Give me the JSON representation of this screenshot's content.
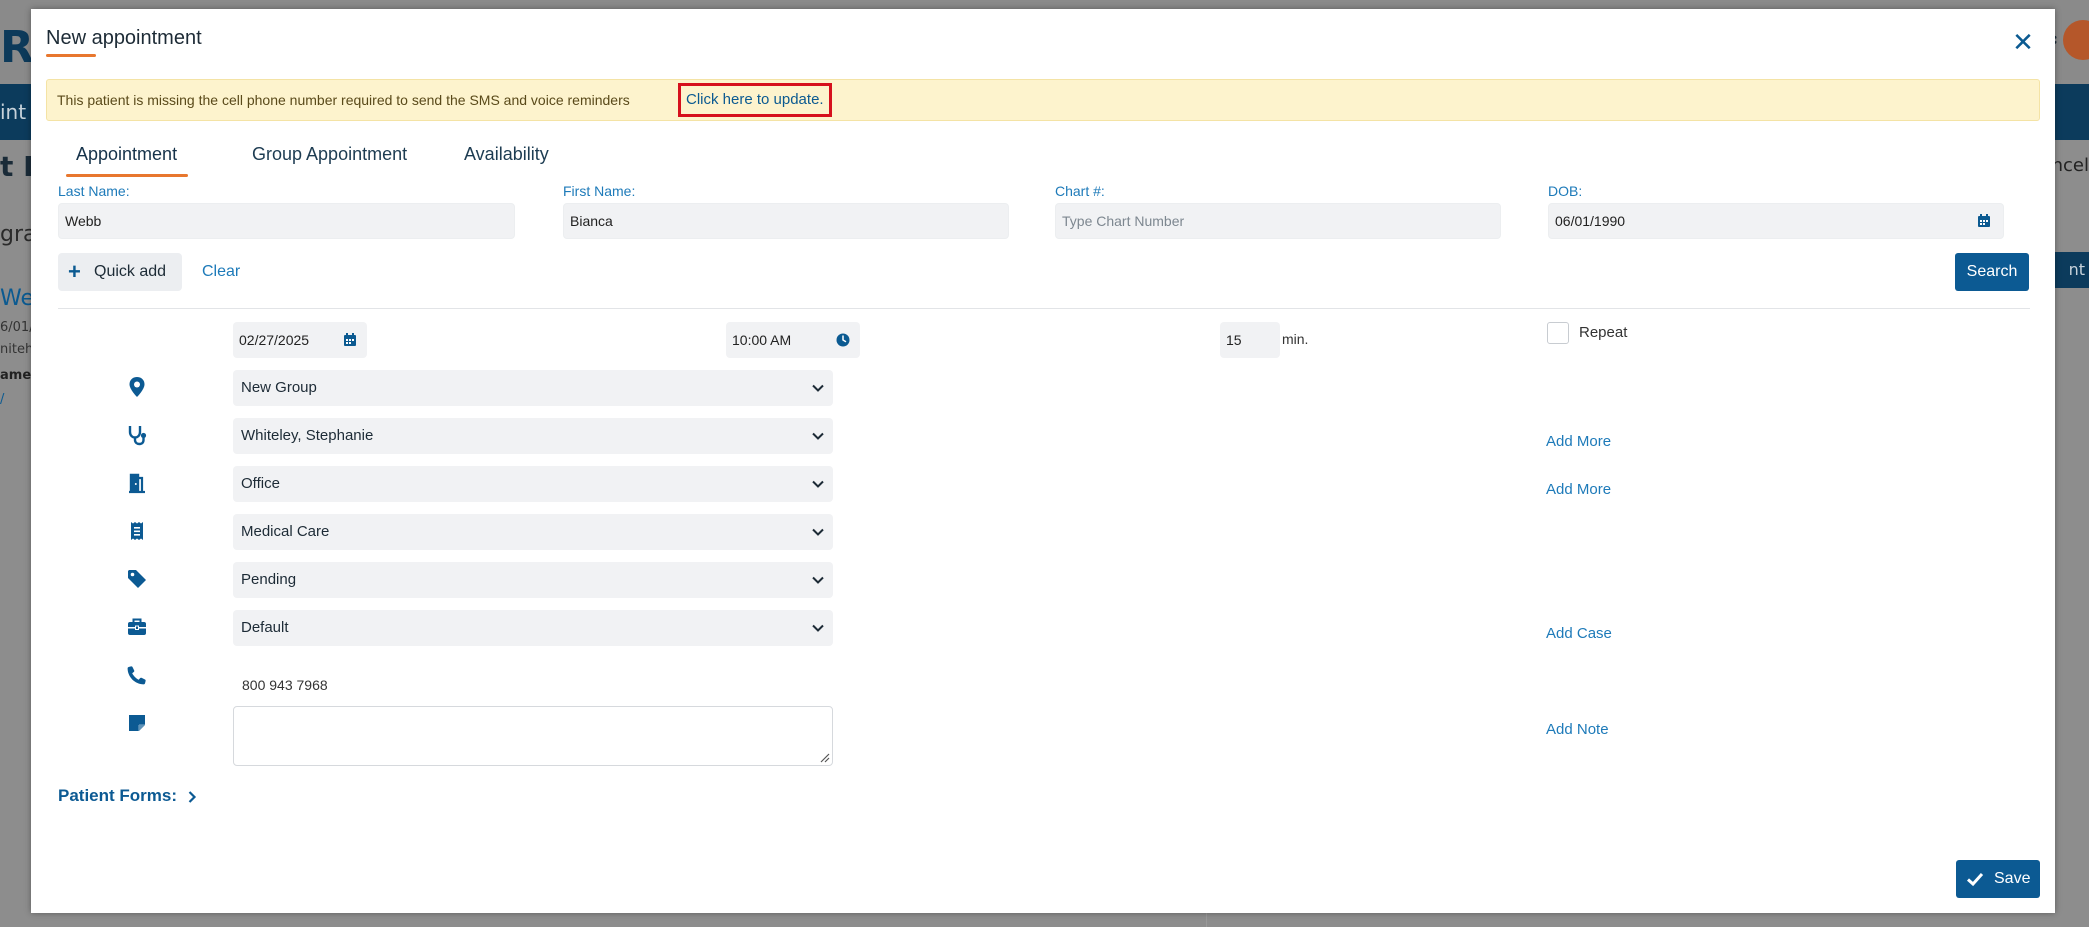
{
  "background": {
    "logo": "R",
    "nav_text": "int",
    "title": "t D",
    "subtitle": "gra",
    "card_link": "Web",
    "card_line1": "6/01/",
    "card_line2": "niteh",
    "card_line3": "ame",
    "card_line4": "/",
    "right_cancel": "ncel",
    "right_button": "nt"
  },
  "modal": {
    "title": "New appointment",
    "close_icon": "close-icon"
  },
  "alert": {
    "text": "This patient is missing the cell phone number required to send the SMS and voice reminders",
    "link": "Click here to update."
  },
  "tabs": [
    {
      "label": "Appointment",
      "active": true
    },
    {
      "label": "Group Appointment",
      "active": false
    },
    {
      "label": "Availability",
      "active": false
    }
  ],
  "patient": {
    "last_name_label": "Last Name:",
    "last_name": "Webb",
    "first_name_label": "First Name:",
    "first_name": "Bianca",
    "chart_label": "Chart #:",
    "chart_placeholder": "Type Chart Number",
    "dob_label": "DOB:",
    "dob": "06/01/1990"
  },
  "actions": {
    "quick_add": "Quick add",
    "clear": "Clear",
    "search": "Search"
  },
  "schedule": {
    "date": "02/27/2025",
    "time": "10:00 AM",
    "duration": "15",
    "duration_unit": "min.",
    "repeat_label": "Repeat",
    "repeat_checked": false
  },
  "rows": {
    "location": "New Group",
    "provider": "Whiteley, Stephanie",
    "room": "Office",
    "type": "Medical Care",
    "status": "Pending",
    "case": "Default",
    "phone": "800 943 7968",
    "note": ""
  },
  "side_links": {
    "provider_add": "Add More",
    "room_add": "Add More",
    "case_add": "Add Case",
    "note_add": "Add Note"
  },
  "footer": {
    "patient_forms": "Patient Forms:",
    "save": "Save"
  },
  "colors": {
    "brand": "#0c5a93",
    "accent": "#e8772e",
    "alert_bg": "#fdf3cd",
    "alert_border": "#d6101d"
  }
}
